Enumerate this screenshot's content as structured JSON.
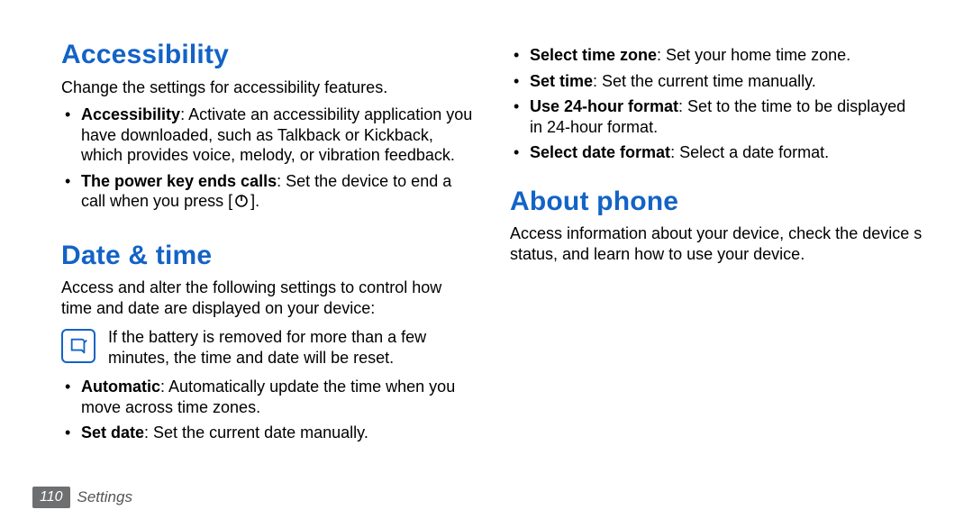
{
  "left": {
    "accessibility": {
      "heading": "Accessibility",
      "intro": "Change the settings for accessibility features.",
      "items": [
        {
          "label": "Accessibility",
          "desc": ": Activate an accessibility application you have downloaded, such as Talkback or Kickback, which provides voice, melody, or vibration feedback."
        },
        {
          "label": "The power key ends calls",
          "desc_a": ": Set the device to end a call when you press [",
          "icon": "power-icon",
          "desc_b": "]."
        }
      ]
    },
    "datetime": {
      "heading": "Date & time",
      "intro": "Access and alter the following settings to control how time and date are displayed on your device:",
      "note": "If the battery is removed for more than a few minutes, the time and date will be reset.",
      "items": [
        {
          "label": "Automatic",
          "desc": ": Automatically update the time when you move across time zones."
        },
        {
          "label": "Set date",
          "desc": ": Set the current date manually."
        }
      ]
    }
  },
  "right": {
    "datetime_cont": {
      "items": [
        {
          "label": "Select time zone",
          "desc": ": Set your home time zone."
        },
        {
          "label": "Set time",
          "desc": ": Set the current time manually."
        },
        {
          "label": "Use 24-hour format",
          "desc": ": Set to the time to be displayed in 24-hour format."
        },
        {
          "label": "Select date format",
          "desc": ": Select a date format."
        }
      ]
    },
    "about": {
      "heading": "About phone",
      "intro": "Access information about your device, check the device s status, and learn how to use your device."
    }
  },
  "footer": {
    "page": "110",
    "section": "Settings"
  }
}
